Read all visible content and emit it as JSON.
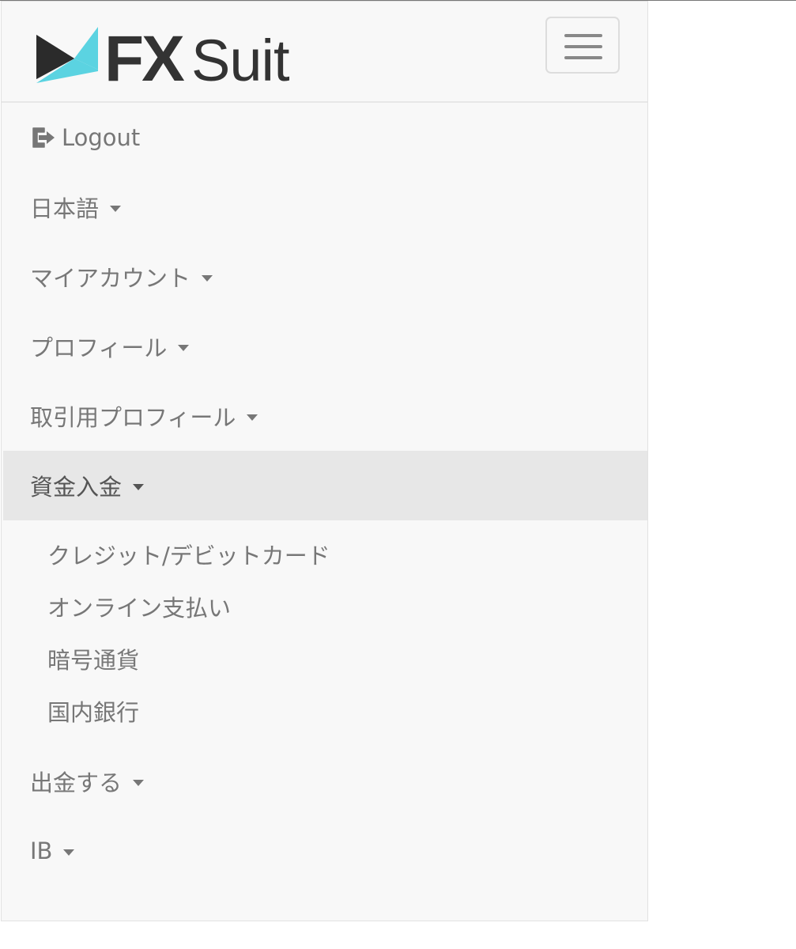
{
  "brand": {
    "name": "FXSuit",
    "colors": {
      "text": "#333333",
      "accent": "#5bd3e1",
      "dark": "#2b2b2b"
    }
  },
  "header": {
    "toggle_icon": "hamburger-icon"
  },
  "menu": {
    "logout": {
      "label": "Logout",
      "icon": "sign-out-icon"
    },
    "items": [
      {
        "label": "日本語"
      },
      {
        "label": "マイアカウント"
      },
      {
        "label": "プロフィール"
      },
      {
        "label": "取引用プロフィール"
      },
      {
        "label": "資金入金"
      },
      {
        "label": "出金する"
      },
      {
        "label": "IB"
      }
    ],
    "deposit_submenu": [
      {
        "label": "クレジット/デビットカード"
      },
      {
        "label": "オンライン支払い"
      },
      {
        "label": "暗号通貨"
      },
      {
        "label": "国内銀行"
      }
    ]
  }
}
